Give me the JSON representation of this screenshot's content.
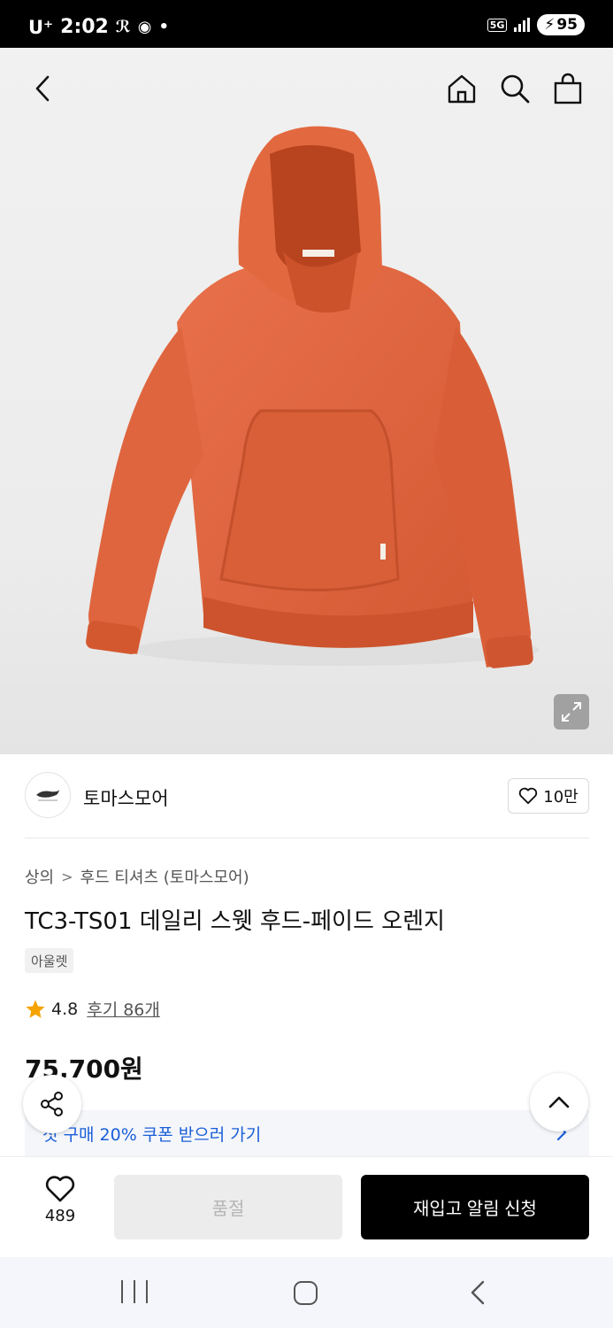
{
  "status_bar": {
    "carrier": "U⁺",
    "time": "2:02",
    "network": "5G",
    "battery": "95"
  },
  "top_nav": {
    "back_icon": "chevron-left-icon",
    "home_icon": "home-icon",
    "search_icon": "search-icon",
    "bag_icon": "shopping-bag-icon"
  },
  "product_image": {
    "subject": "orange hoodie",
    "expand_icon": "expand-icon"
  },
  "seller": {
    "name": "토마스모어",
    "likes": "10만"
  },
  "breadcrumb": {
    "level1": "상의",
    "separator": ">",
    "level2": "후드 티셔츠 (토마스모어)"
  },
  "product": {
    "title": "TC3-TS01 데일리 스웻 후드-페이드 오렌지",
    "tag": "아울렛",
    "rating": "4.8",
    "reviews": "후기 86개",
    "price": "75,700원"
  },
  "coupon": {
    "text": "첫 구매 20% 쿠폰 받으러 가기"
  },
  "bottom_bar": {
    "wish_count": "489",
    "soldout_label": "품절",
    "restock_label": "재입고 알림 신청"
  },
  "colors": {
    "accent_blue": "#1a5ed8",
    "star": "#f5a300",
    "hoodie": "#e0643c"
  }
}
